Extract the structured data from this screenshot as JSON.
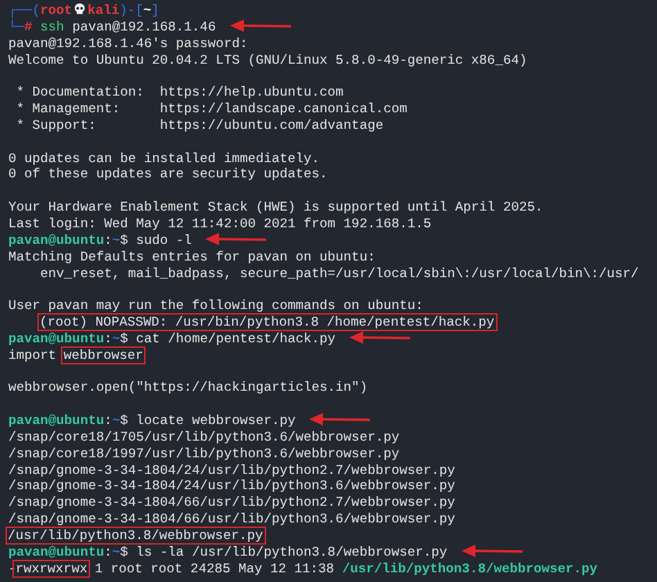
{
  "terminal": {
    "lines": [
      {
        "kind": "output",
        "segments": [
          {
            "kind": "frame",
            "text": "┌──("
          },
          {
            "kind": "root",
            "text": "root"
          },
          {
            "kind": "skull"
          },
          {
            "kind": "root",
            "text": "kali"
          },
          {
            "kind": "frame",
            "text": ")-["
          },
          {
            "kind": "cwd",
            "text": "~"
          },
          {
            "kind": "frame",
            "text": "]"
          }
        ]
      },
      {
        "kind": "output",
        "segments": [
          {
            "kind": "frame",
            "text": "└─"
          },
          {
            "kind": "hash",
            "text": "# "
          },
          {
            "kind": "cmd",
            "text": "ssh"
          },
          {
            "kind": "text",
            "text": " pavan@192.168.1.46"
          }
        ],
        "arrow": true
      },
      {
        "kind": "output",
        "segments": [
          {
            "kind": "text",
            "text": "pavan@192.168.1.46's password:"
          }
        ]
      },
      {
        "kind": "output",
        "segments": [
          {
            "kind": "text",
            "text": "Welcome to Ubuntu 20.04.2 LTS (GNU/Linux 5.8.0-49-generic x86_64)"
          }
        ]
      },
      {
        "kind": "blank"
      },
      {
        "kind": "output",
        "segments": [
          {
            "kind": "text",
            "text": " * Documentation:  https://help.ubuntu.com"
          }
        ]
      },
      {
        "kind": "output",
        "segments": [
          {
            "kind": "text",
            "text": " * Management:     https://landscape.canonical.com"
          }
        ]
      },
      {
        "kind": "output",
        "segments": [
          {
            "kind": "text",
            "text": " * Support:        https://ubuntu.com/advantage"
          }
        ]
      },
      {
        "kind": "blank"
      },
      {
        "kind": "output",
        "segments": [
          {
            "kind": "text",
            "text": "0 updates can be installed immediately."
          }
        ]
      },
      {
        "kind": "output",
        "segments": [
          {
            "kind": "text",
            "text": "0 of these updates are security updates."
          }
        ]
      },
      {
        "kind": "blank"
      },
      {
        "kind": "output",
        "segments": [
          {
            "kind": "text",
            "text": "Your Hardware Enablement Stack (HWE) is supported until April 2025."
          }
        ]
      },
      {
        "kind": "output",
        "segments": [
          {
            "kind": "text",
            "text": "Last login: Wed May 12 11:42:00 2021 from 192.168.1.5"
          }
        ]
      },
      {
        "kind": "output",
        "segments": [
          {
            "kind": "user",
            "text": "pavan@ubuntu"
          },
          {
            "kind": "text",
            "text": ":"
          },
          {
            "kind": "dir",
            "text": "~"
          },
          {
            "kind": "text",
            "text": "$ sudo -l"
          }
        ],
        "arrow": true
      },
      {
        "kind": "output",
        "segments": [
          {
            "kind": "text",
            "text": "Matching Defaults entries for pavan on ubuntu:"
          }
        ]
      },
      {
        "kind": "output",
        "segments": [
          {
            "kind": "text",
            "text": "    env_reset, mail_badpass, secure_path=/usr/local/sbin\\:/usr/local/bin\\:/usr/"
          }
        ]
      },
      {
        "kind": "blank"
      },
      {
        "kind": "output",
        "segments": [
          {
            "kind": "text",
            "text": "User pavan may run the following commands on ubuntu:"
          }
        ]
      },
      {
        "kind": "output",
        "indent": true,
        "segments": [
          {
            "kind": "text",
            "text": "(root) NOPASSWD: /usr/bin/python3.8 /home/pentest/hack.py",
            "boxed": true
          }
        ]
      },
      {
        "kind": "output",
        "segments": [
          {
            "kind": "user",
            "text": "pavan@ubuntu"
          },
          {
            "kind": "text",
            "text": ":"
          },
          {
            "kind": "dir",
            "text": "~"
          },
          {
            "kind": "text",
            "text": "$ cat /home/pentest/hack.py"
          }
        ],
        "arrow": true
      },
      {
        "kind": "output",
        "segments": [
          {
            "kind": "text",
            "text": "import "
          },
          {
            "kind": "text",
            "text": "webbrowser",
            "boxed": true
          }
        ]
      },
      {
        "kind": "blank"
      },
      {
        "kind": "output",
        "segments": [
          {
            "kind": "text",
            "text": "webbrowser.open(\"https://hackingarticles.in\")"
          }
        ]
      },
      {
        "kind": "blank"
      },
      {
        "kind": "output",
        "segments": [
          {
            "kind": "user",
            "text": "pavan@ubuntu"
          },
          {
            "kind": "text",
            "text": ":"
          },
          {
            "kind": "dir",
            "text": "~"
          },
          {
            "kind": "text",
            "text": "$ locate webbrowser.py"
          }
        ],
        "arrow": true
      },
      {
        "kind": "output",
        "segments": [
          {
            "kind": "text",
            "text": "/snap/core18/1705/usr/lib/python3.6/webbrowser.py"
          }
        ]
      },
      {
        "kind": "output",
        "segments": [
          {
            "kind": "text",
            "text": "/snap/core18/1997/usr/lib/python3.6/webbrowser.py"
          }
        ]
      },
      {
        "kind": "output",
        "segments": [
          {
            "kind": "text",
            "text": "/snap/gnome-3-34-1804/24/usr/lib/python2.7/webbrowser.py"
          }
        ]
      },
      {
        "kind": "output",
        "segments": [
          {
            "kind": "text",
            "text": "/snap/gnome-3-34-1804/24/usr/lib/python3.6/webbrowser.py"
          }
        ]
      },
      {
        "kind": "output",
        "segments": [
          {
            "kind": "text",
            "text": "/snap/gnome-3-34-1804/66/usr/lib/python2.7/webbrowser.py"
          }
        ]
      },
      {
        "kind": "output",
        "segments": [
          {
            "kind": "text",
            "text": "/snap/gnome-3-34-1804/66/usr/lib/python3.6/webbrowser.py"
          }
        ]
      },
      {
        "kind": "output",
        "segments": [
          {
            "kind": "text",
            "text": "/usr/lib/python3.8/webbrowser.py",
            "boxed": true
          }
        ]
      },
      {
        "kind": "output",
        "segments": [
          {
            "kind": "user",
            "text": "pavan@ubuntu"
          },
          {
            "kind": "text",
            "text": ":"
          },
          {
            "kind": "dir",
            "text": "~"
          },
          {
            "kind": "text",
            "text": "$ ls -la /usr/lib/python3.8/webbrowser.py"
          }
        ],
        "arrow": true
      },
      {
        "kind": "output",
        "segments": [
          {
            "kind": "text",
            "text": "-"
          },
          {
            "kind": "text",
            "text": "rwxrwxrwx",
            "boxed": true
          },
          {
            "kind": "text",
            "text": " 1 root root 24285 May 12 11:38 "
          },
          {
            "kind": "link",
            "text": "/usr/lib/python3.8/webbrowser.py"
          }
        ]
      }
    ]
  }
}
